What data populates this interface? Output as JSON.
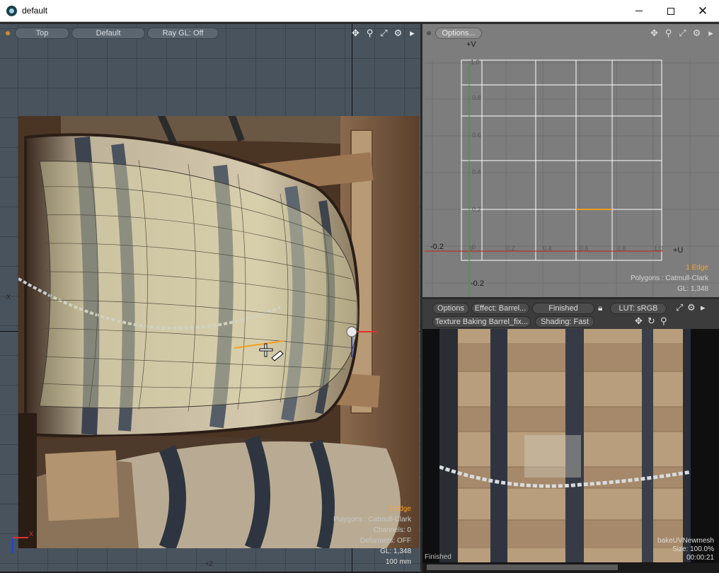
{
  "window": {
    "title": "default",
    "icon": "modo-app-icon",
    "controls": [
      "minimize-icon",
      "maximize-icon",
      "close-icon"
    ]
  },
  "left_viewport": {
    "view_label": "Top",
    "style_label": "Default",
    "raygl_label": "Ray GL: Off",
    "tool_icons": [
      "move-icon",
      "zoom-icon",
      "fit-icon",
      "gear-icon",
      "expand-arrow-icon"
    ],
    "axis_labels": {
      "left": "-X",
      "bottom": "+Z"
    },
    "info": {
      "selection": "1 Edge",
      "polygons": "Polygons : Catmull-Clark",
      "channels": "Channels: 0",
      "deformers": "Deformers: OFF",
      "gl": "GL: 1,348",
      "scale": "100 mm"
    },
    "colors": {
      "selection": "#f5a52a",
      "x_axis": "#e03030",
      "z_axis": "#2040e0"
    }
  },
  "uv_viewport": {
    "options_label": "Options...",
    "tool_icons": [
      "move-icon",
      "zoom-icon",
      "fit-icon",
      "gear-icon",
      "expand-arrow-icon"
    ],
    "v_label": "+V",
    "u_label": "+U",
    "v_ticks": [
      "1.0",
      "0.8",
      "0.6",
      "0.4",
      "0.2",
      "0",
      "-0.2"
    ],
    "u_ticks": [
      "-0.2",
      "0",
      "0.2",
      "0.4",
      "0.6",
      "0.8",
      "1.0"
    ],
    "info": {
      "selection": "1 Edge",
      "polygons": "Polygons : Catmull-Clark",
      "gl": "GL: 1,348"
    }
  },
  "bake_viewport": {
    "options_label": "Options",
    "effect_label": "Effect: Barrel...",
    "status_button": "Finished",
    "lut_label": "LUT: sRGB",
    "texture_label": "Texture Baking Barrel_fix...",
    "shading_label": "Shading: Fast",
    "tool_icons": [
      "lock-icon",
      "expand-icon",
      "gear-icon",
      "play-arrow-icon"
    ],
    "view_icons": [
      "move-icon",
      "refresh-icon",
      "zoom-icon"
    ],
    "status": "Finished",
    "info": {
      "name": "bakeUVNewmesh",
      "size": "Size: 100.0%",
      "time": "00:00:21"
    }
  }
}
